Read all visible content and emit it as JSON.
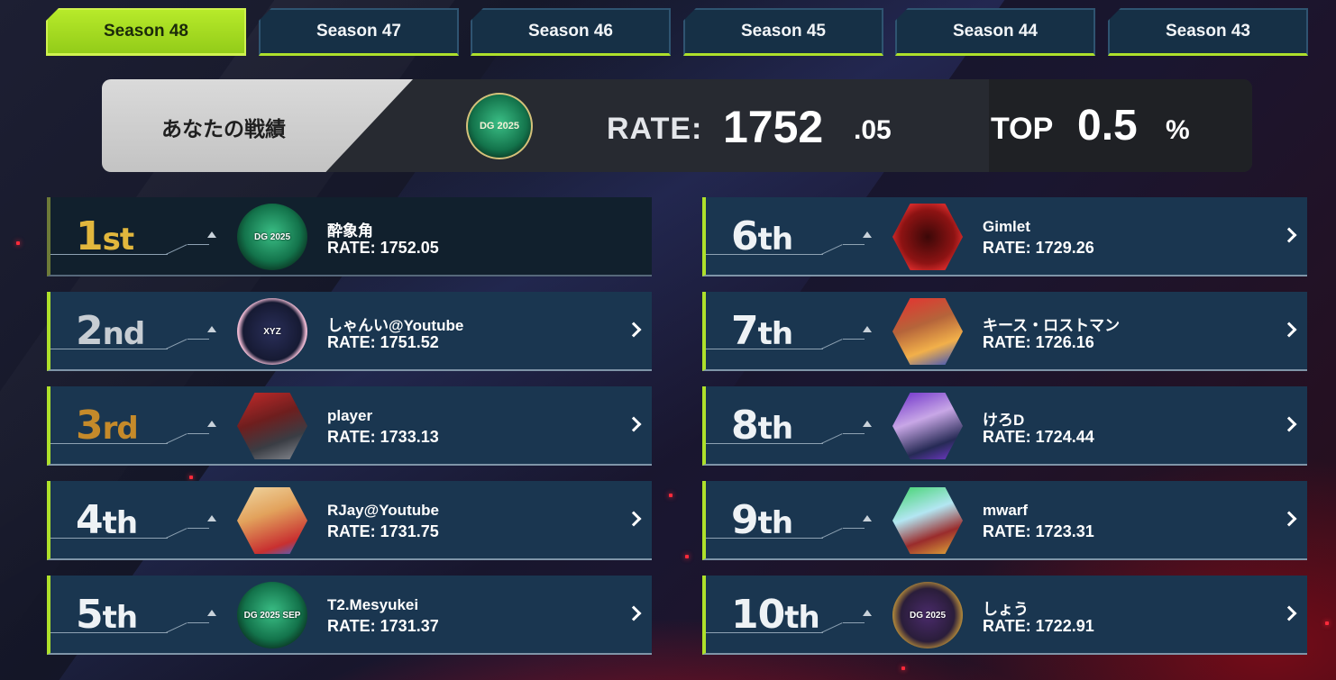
{
  "tabs": [
    {
      "label": "Season 48",
      "active": true
    },
    {
      "label": "Season 47",
      "active": false
    },
    {
      "label": "Season 46",
      "active": false
    },
    {
      "label": "Season 45",
      "active": false
    },
    {
      "label": "Season 44",
      "active": false
    },
    {
      "label": "Season 43",
      "active": false
    }
  ],
  "record": {
    "label": "あなたの戦績",
    "rate_prefix": "RATE:",
    "rate_main": "1752",
    "rate_dec": ".05",
    "top_prefix": "TOP",
    "top_value": "0.5",
    "top_pct": "%",
    "emblem": "DG 2025",
    "emblem_icon": "dg-emblem-icon"
  },
  "ranking": [
    {
      "rank_num": "1",
      "rank_suf": "st",
      "name": "酔象角",
      "rate": "RATE: 1752.05",
      "emblem": "DG 2025",
      "icon": "dg-emblem-icon",
      "self": true
    },
    {
      "rank_num": "2",
      "rank_suf": "nd",
      "name": "しゃんい@Youtube",
      "rate": "RATE: 1751.52",
      "emblem": "XYZ",
      "icon": "xyz-emblem-icon",
      "self": false
    },
    {
      "rank_num": "3",
      "rank_suf": "rd",
      "name": "player",
      "rate": "RATE: 1733.13",
      "emblem": "",
      "icon": "player-avatar-icon",
      "self": false
    },
    {
      "rank_num": "4",
      "rank_suf": "th",
      "name": "RJay@Youtube",
      "rate": "RATE: 1731.75",
      "emblem": "",
      "icon": "character-avatar-icon",
      "self": false
    },
    {
      "rank_num": "5",
      "rank_suf": "th",
      "name": "T2.Mesyukei",
      "rate": "RATE: 1731.37",
      "emblem": "DG 2025 SEP",
      "icon": "dg-emblem-icon",
      "self": false
    },
    {
      "rank_num": "6",
      "rank_suf": "th",
      "name": "Gimlet",
      "rate": "RATE: 1729.26",
      "emblem": "",
      "icon": "red-crest-icon",
      "self": false
    },
    {
      "rank_num": "7",
      "rank_suf": "th",
      "name": "キース・ロストマン",
      "rate": "RATE: 1726.16",
      "emblem": "",
      "icon": "robot-avatar-icon",
      "self": false
    },
    {
      "rank_num": "8",
      "rank_suf": "th",
      "name": "けろD",
      "rate": "RATE: 1724.44",
      "emblem": "",
      "icon": "mage-avatar-icon",
      "self": false
    },
    {
      "rank_num": "9",
      "rank_suf": "th",
      "name": "mwarf",
      "rate": "RATE: 1723.31",
      "emblem": "",
      "icon": "jellyfish-avatar-icon",
      "self": false
    },
    {
      "rank_num": "10",
      "rank_suf": "th",
      "name": "しょう",
      "rate": "RATE: 1722.91",
      "emblem": "DG 2025",
      "icon": "witch-emblem-icon",
      "self": false
    }
  ],
  "colors": {
    "accent": "#aee02b",
    "row_bg": "#1a3650",
    "gold": "#e2b73d",
    "bronze": "#c58a2a"
  }
}
